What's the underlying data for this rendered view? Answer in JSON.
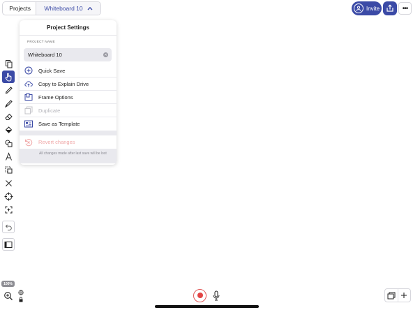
{
  "nav": {
    "back_label": "Projects",
    "project_title": "Whiteboard 10"
  },
  "topbar": {
    "invite_label": "Invite",
    "more_label": "•••"
  },
  "popover": {
    "title": "Project Settings",
    "section_label": "PROJECT NAME",
    "name_value": "Whiteboard 10",
    "items": [
      {
        "label": "Quick Save",
        "icon": "plus-circle-icon",
        "enabled": true
      },
      {
        "label": "Copy to Explain Drive",
        "icon": "cloud-upload-icon",
        "enabled": true
      },
      {
        "label": "Frame Options",
        "icon": "frame-icon",
        "enabled": true
      },
      {
        "label": "Duplicate",
        "icon": "duplicate-icon",
        "enabled": false
      },
      {
        "label": "Save as Template",
        "icon": "template-icon",
        "enabled": true
      }
    ],
    "revert_label": "Revert changes",
    "revert_note": "All changes made after last save will be lost"
  },
  "zoom": {
    "level": "100%"
  },
  "colors": {
    "accent": "#3b4aa6",
    "record": "#e24444",
    "danger_text": "#f0a8a8"
  }
}
